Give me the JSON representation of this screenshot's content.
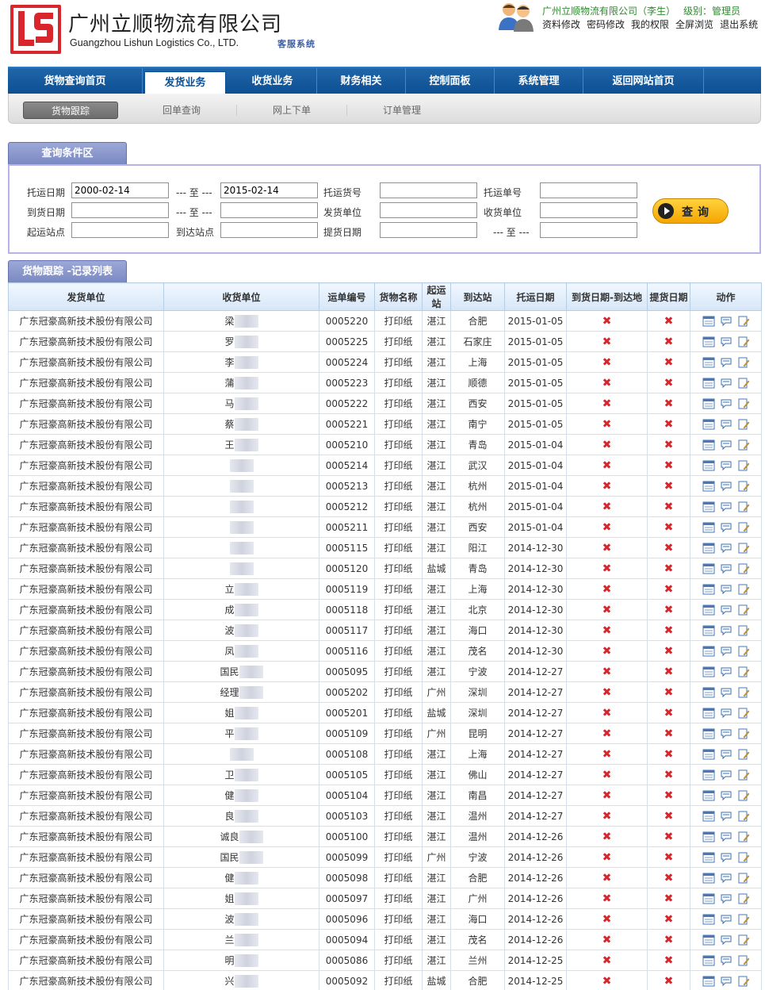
{
  "header": {
    "company_cn": "广州立顺物流有限公司",
    "company_en": "Guangzhou Lishun Logistics Co., LTD.",
    "system_name": "客服系统",
    "user_info": "广州立顺物流有限公司（李生）",
    "level": "级别：管理员",
    "links": [
      "资料修改",
      "密码修改",
      "我的权限",
      "全屏浏览",
      "退出系统"
    ]
  },
  "nav": {
    "items": [
      "货物查询首页",
      "发货业务",
      "收货业务",
      "财务相关",
      "控制面板",
      "系统管理",
      "返回网站首页"
    ],
    "active": "发货业务"
  },
  "subnav": {
    "items": [
      "货物跟踪",
      "回单查询",
      "网上下单",
      "订单管理"
    ],
    "active": "货物跟踪"
  },
  "query": {
    "tab_title": "查询条件区",
    "labels": {
      "ship_date": "托运日期",
      "to": "--- 至 ---",
      "arrive_date": "到货日期",
      "start_station": "起运站点",
      "end_station": "到达站点",
      "cargo_no": "托运货号",
      "sender": "发货单位",
      "pickup_date": "提货日期",
      "order_no": "托运单号",
      "receiver": "收货单位"
    },
    "values": {
      "ship_from": "2000-02-14",
      "ship_to": "2015-02-14"
    },
    "button": "查询"
  },
  "list": {
    "tab_title": "货物跟踪 -记录列表",
    "headers": [
      "发货单位",
      "收货单位",
      "运单编号",
      "货物名称",
      "起运站",
      "到达站",
      "托运日期",
      "到货日期-到达地",
      "提货日期",
      "动作"
    ],
    "rows": [
      {
        "sender": "广东冠豪高新技术股份有限公司",
        "receiver": "梁",
        "no": "0005220",
        "goods": "打印纸",
        "from": "湛江",
        "to": "合肥",
        "date": "2015-01-05"
      },
      {
        "sender": "广东冠豪高新技术股份有限公司",
        "receiver": "罗",
        "no": "0005225",
        "goods": "打印纸",
        "from": "湛江",
        "to": "石家庄",
        "date": "2015-01-05"
      },
      {
        "sender": "广东冠豪高新技术股份有限公司",
        "receiver": "李",
        "no": "0005224",
        "goods": "打印纸",
        "from": "湛江",
        "to": "上海",
        "date": "2015-01-05"
      },
      {
        "sender": "广东冠豪高新技术股份有限公司",
        "receiver": "蒲",
        "no": "0005223",
        "goods": "打印纸",
        "from": "湛江",
        "to": "顺德",
        "date": "2015-01-05"
      },
      {
        "sender": "广东冠豪高新技术股份有限公司",
        "receiver": "马",
        "no": "0005222",
        "goods": "打印纸",
        "from": "湛江",
        "to": "西安",
        "date": "2015-01-05"
      },
      {
        "sender": "广东冠豪高新技术股份有限公司",
        "receiver": "蔡",
        "no": "0005221",
        "goods": "打印纸",
        "from": "湛江",
        "to": "南宁",
        "date": "2015-01-05"
      },
      {
        "sender": "广东冠豪高新技术股份有限公司",
        "receiver": "王",
        "no": "0005210",
        "goods": "打印纸",
        "from": "湛江",
        "to": "青岛",
        "date": "2015-01-04"
      },
      {
        "sender": "广东冠豪高新技术股份有限公司",
        "receiver": "",
        "no": "0005214",
        "goods": "打印纸",
        "from": "湛江",
        "to": "武汉",
        "date": "2015-01-04"
      },
      {
        "sender": "广东冠豪高新技术股份有限公司",
        "receiver": "",
        "no": "0005213",
        "goods": "打印纸",
        "from": "湛江",
        "to": "杭州",
        "date": "2015-01-04"
      },
      {
        "sender": "广东冠豪高新技术股份有限公司",
        "receiver": "",
        "no": "0005212",
        "goods": "打印纸",
        "from": "湛江",
        "to": "杭州",
        "date": "2015-01-04"
      },
      {
        "sender": "广东冠豪高新技术股份有限公司",
        "receiver": "",
        "no": "0005211",
        "goods": "打印纸",
        "from": "湛江",
        "to": "西安",
        "date": "2015-01-04"
      },
      {
        "sender": "广东冠豪高新技术股份有限公司",
        "receiver": "",
        "no": "0005115",
        "goods": "打印纸",
        "from": "湛江",
        "to": "阳江",
        "date": "2014-12-30"
      },
      {
        "sender": "广东冠豪高新技术股份有限公司",
        "receiver": "",
        "no": "0005120",
        "goods": "打印纸",
        "from": "盐城",
        "to": "青岛",
        "date": "2014-12-30"
      },
      {
        "sender": "广东冠豪高新技术股份有限公司",
        "receiver": "立",
        "no": "0005119",
        "goods": "打印纸",
        "from": "湛江",
        "to": "上海",
        "date": "2014-12-30"
      },
      {
        "sender": "广东冠豪高新技术股份有限公司",
        "receiver": "成",
        "no": "0005118",
        "goods": "打印纸",
        "from": "湛江",
        "to": "北京",
        "date": "2014-12-30"
      },
      {
        "sender": "广东冠豪高新技术股份有限公司",
        "receiver": "波",
        "no": "0005117",
        "goods": "打印纸",
        "from": "湛江",
        "to": "海口",
        "date": "2014-12-30"
      },
      {
        "sender": "广东冠豪高新技术股份有限公司",
        "receiver": "凤",
        "no": "0005116",
        "goods": "打印纸",
        "from": "湛江",
        "to": "茂名",
        "date": "2014-12-30"
      },
      {
        "sender": "广东冠豪高新技术股份有限公司",
        "receiver": "国民",
        "no": "0005095",
        "goods": "打印纸",
        "from": "湛江",
        "to": "宁波",
        "date": "2014-12-27"
      },
      {
        "sender": "广东冠豪高新技术股份有限公司",
        "receiver": "经理",
        "no": "0005202",
        "goods": "打印纸",
        "from": "广州",
        "to": "深圳",
        "date": "2014-12-27"
      },
      {
        "sender": "广东冠豪高新技术股份有限公司",
        "receiver": "姐",
        "no": "0005201",
        "goods": "打印纸",
        "from": "盐城",
        "to": "深圳",
        "date": "2014-12-27"
      },
      {
        "sender": "广东冠豪高新技术股份有限公司",
        "receiver": "平",
        "no": "0005109",
        "goods": "打印纸",
        "from": "广州",
        "to": "昆明",
        "date": "2014-12-27"
      },
      {
        "sender": "广东冠豪高新技术股份有限公司",
        "receiver": "",
        "no": "0005108",
        "goods": "打印纸",
        "from": "湛江",
        "to": "上海",
        "date": "2014-12-27"
      },
      {
        "sender": "广东冠豪高新技术股份有限公司",
        "receiver": "卫",
        "no": "0005105",
        "goods": "打印纸",
        "from": "湛江",
        "to": "佛山",
        "date": "2014-12-27"
      },
      {
        "sender": "广东冠豪高新技术股份有限公司",
        "receiver": "健",
        "no": "0005104",
        "goods": "打印纸",
        "from": "湛江",
        "to": "南昌",
        "date": "2014-12-27"
      },
      {
        "sender": "广东冠豪高新技术股份有限公司",
        "receiver": "良",
        "no": "0005103",
        "goods": "打印纸",
        "from": "湛江",
        "to": "温州",
        "date": "2014-12-27"
      },
      {
        "sender": "广东冠豪高新技术股份有限公司",
        "receiver": "诚良",
        "no": "0005100",
        "goods": "打印纸",
        "from": "湛江",
        "to": "温州",
        "date": "2014-12-26"
      },
      {
        "sender": "广东冠豪高新技术股份有限公司",
        "receiver": "国民",
        "no": "0005099",
        "goods": "打印纸",
        "from": "广州",
        "to": "宁波",
        "date": "2014-12-26"
      },
      {
        "sender": "广东冠豪高新技术股份有限公司",
        "receiver": "健",
        "no": "0005098",
        "goods": "打印纸",
        "from": "湛江",
        "to": "合肥",
        "date": "2014-12-26"
      },
      {
        "sender": "广东冠豪高新技术股份有限公司",
        "receiver": "姐",
        "no": "0005097",
        "goods": "打印纸",
        "from": "湛江",
        "to": "广州",
        "date": "2014-12-26"
      },
      {
        "sender": "广东冠豪高新技术股份有限公司",
        "receiver": "波",
        "no": "0005096",
        "goods": "打印纸",
        "from": "湛江",
        "to": "海口",
        "date": "2014-12-26"
      },
      {
        "sender": "广东冠豪高新技术股份有限公司",
        "receiver": "兰",
        "no": "0005094",
        "goods": "打印纸",
        "from": "湛江",
        "to": "茂名",
        "date": "2014-12-26"
      },
      {
        "sender": "广东冠豪高新技术股份有限公司",
        "receiver": "明",
        "no": "0005086",
        "goods": "打印纸",
        "from": "湛江",
        "to": "兰州",
        "date": "2014-12-25"
      },
      {
        "sender": "广东冠豪高新技术股份有限公司",
        "receiver": "兴",
        "no": "0005092",
        "goods": "打印纸",
        "from": "盐城",
        "to": "合肥",
        "date": "2014-12-25"
      }
    ],
    "status_icon": "x-mark-icon",
    "action_icons": [
      "detail-icon",
      "comment-icon",
      "edit-icon"
    ]
  },
  "colors": {
    "brand_red": "#d9262c",
    "nav_blue": "#0d4f93",
    "tab_purple": "#7b89c3",
    "button_gold": "#f5a500"
  }
}
